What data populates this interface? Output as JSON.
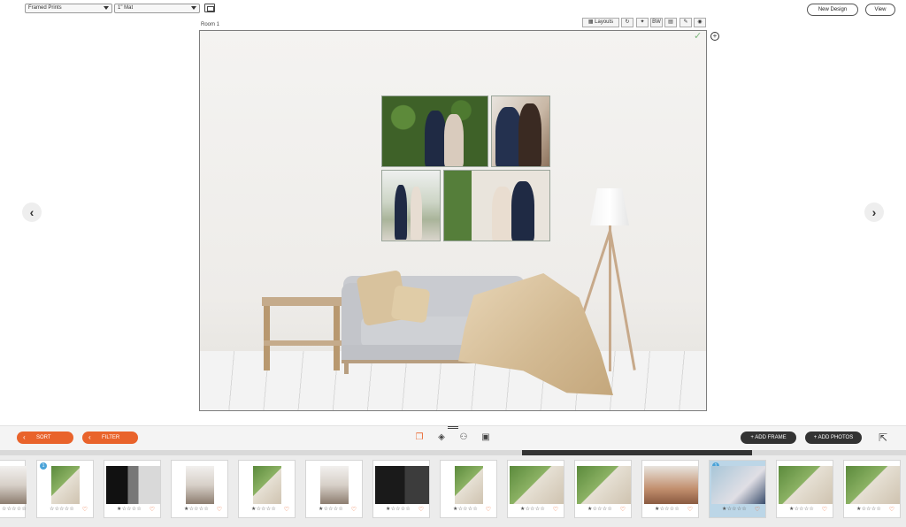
{
  "top_bar": {
    "product_select": "Framed Prints",
    "mat_select": "1\" Mat",
    "new_design_label": "New Design",
    "view_label": "View"
  },
  "room_toolbar": {
    "layouts_label": "Layouts",
    "bw_label": "BW"
  },
  "room": {
    "label": "Room 1"
  },
  "bottom_bar": {
    "sort_label": "SORT",
    "filter_label": "FILTER",
    "add_frame_label": "+ ADD FRAME",
    "add_photos_label": "+ ADD PHOTOS"
  },
  "film_strip": {
    "stars": "☆☆☆☆☆",
    "stars_first_filled": "★☆☆☆☆",
    "heart": "♡",
    "badge": "1"
  },
  "colors": {
    "accent_orange": "#e9632b",
    "dark_button": "#333333",
    "selected_card": "#bcd6e7",
    "badge_blue": "#4aa3d8"
  },
  "icons": [
    "monitor-rect-icon",
    "grid-icon",
    "rotate-icon",
    "pin-icon",
    "calculator-icon",
    "pencil-icon",
    "eye-icon",
    "check-icon",
    "plus-circle-icon",
    "chevron-left-icon",
    "chevron-right-icon",
    "copy-icon",
    "layers-icon",
    "people-icon",
    "frame-icon",
    "export-icon",
    "heart-icon"
  ]
}
